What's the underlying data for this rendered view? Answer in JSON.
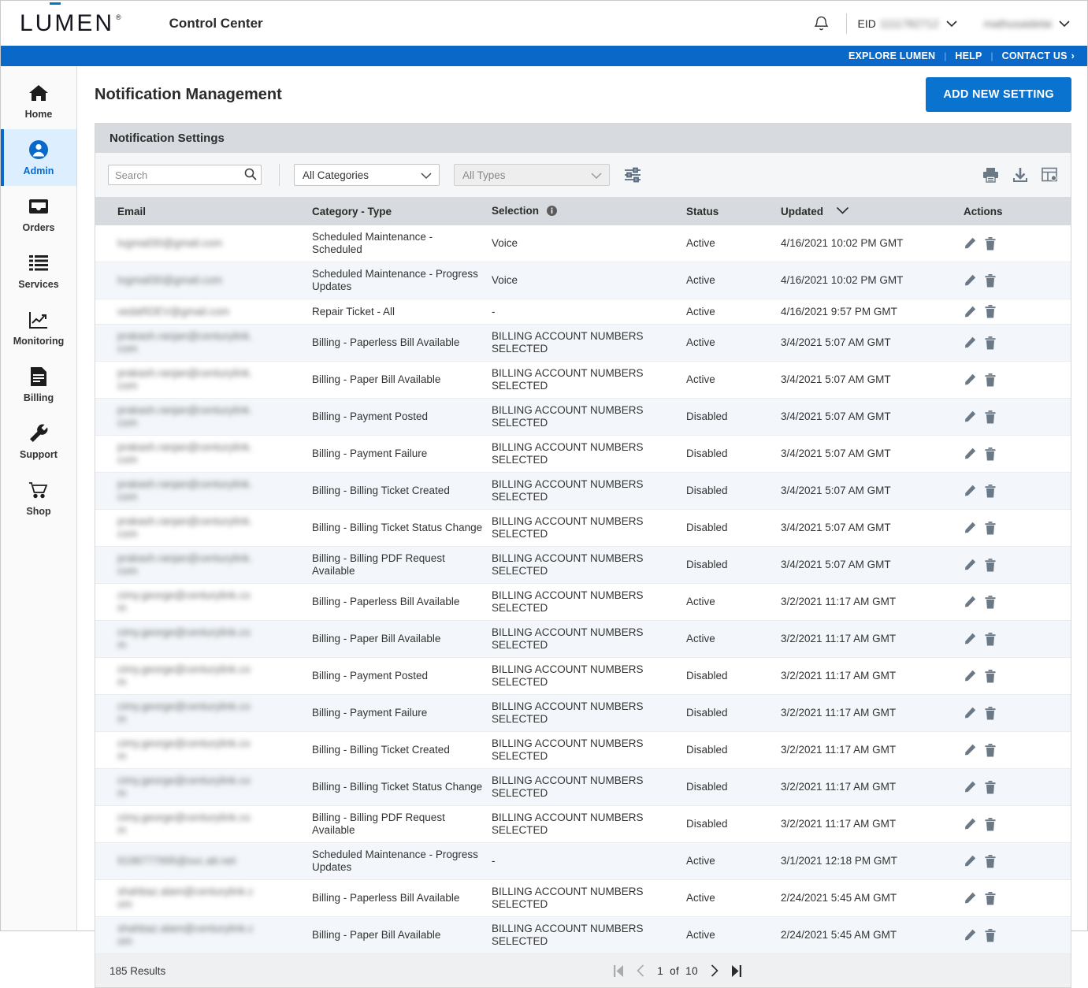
{
  "header": {
    "logo_text": "LUMEN",
    "logo_registered": "®",
    "app_title": "Control Center",
    "bell_icon": "bell-icon",
    "eid_label": "EID",
    "eid_value": "1111782712",
    "account_value": "mathusaidelai",
    "chevron": "⌄"
  },
  "bluebar": {
    "explore": "EXPLORE LUMEN",
    "help": "HELP",
    "contact": "CONTACT US",
    "contact_arrow": "›",
    "separator": "|"
  },
  "sidebar": {
    "items": [
      {
        "label": "Home",
        "icon": "home-icon",
        "active": false
      },
      {
        "label": "Admin",
        "icon": "user-circle-icon",
        "active": true
      },
      {
        "label": "Orders",
        "icon": "inbox-icon",
        "active": false
      },
      {
        "label": "Services",
        "icon": "list-icon",
        "active": false
      },
      {
        "label": "Monitoring",
        "icon": "chart-line-icon",
        "active": false
      },
      {
        "label": "Billing",
        "icon": "invoice-icon",
        "active": false
      },
      {
        "label": "Support",
        "icon": "wrench-icon",
        "active": false
      },
      {
        "label": "Shop",
        "icon": "cart-icon",
        "active": false
      }
    ]
  },
  "page": {
    "title": "Notification Management",
    "add_button": "ADD NEW SETTING",
    "panel_title": "Notification Settings"
  },
  "toolbar": {
    "search_placeholder": "Search",
    "search_value": "",
    "search_icon": "search-icon",
    "category_filter": "All Categories",
    "type_filter": "All Types",
    "filter_icon": "sliders-icon",
    "print_icon": "print-icon",
    "download_icon": "download-icon",
    "columns_icon": "table-settings-icon"
  },
  "table": {
    "columns": {
      "email": "Email",
      "category": "Category - Type",
      "selection": "Selection",
      "status": "Status",
      "updated": "Updated",
      "actions": "Actions"
    },
    "selection_info_icon": "info-icon",
    "updated_sort_icon": "chevron-down-icon",
    "edit_icon": "pencil-icon",
    "delete_icon": "trash-icon",
    "rows": [
      {
        "email": "tvgmail30@gmail.com",
        "category": "Scheduled Maintenance - Scheduled",
        "selection": "Voice",
        "status": "Active",
        "updated": "4/16/2021 10:02 PM GMT"
      },
      {
        "email": "tvgmail30@gmail.com",
        "category": "Scheduled Maintenance - Progress Updates",
        "selection": "Voice",
        "status": "Active",
        "updated": "4/16/2021 10:02 PM GMT"
      },
      {
        "email": "vedaRDEV@gmail.com",
        "category": "Repair Ticket - All",
        "selection": "-",
        "status": "Active",
        "updated": "4/16/2021 9:57 PM GMT"
      },
      {
        "email": "prakash.ranjan@centurylink.com",
        "category": "Billing - Paperless Bill Available",
        "selection": "BILLING ACCOUNT NUMBERS SELECTED",
        "status": "Active",
        "updated": "3/4/2021 5:07 AM GMT"
      },
      {
        "email": "prakash.ranjan@centurylink.com",
        "category": "Billing - Paper Bill Available",
        "selection": "BILLING ACCOUNT NUMBERS SELECTED",
        "status": "Active",
        "updated": "3/4/2021 5:07 AM GMT"
      },
      {
        "email": "prakash.ranjan@centurylink.com",
        "category": "Billing - Payment Posted",
        "selection": "BILLING ACCOUNT NUMBERS SELECTED",
        "status": "Disabled",
        "updated": "3/4/2021 5:07 AM GMT"
      },
      {
        "email": "prakash.ranjan@centurylink.com",
        "category": "Billing - Payment Failure",
        "selection": "BILLING ACCOUNT NUMBERS SELECTED",
        "status": "Disabled",
        "updated": "3/4/2021 5:07 AM GMT"
      },
      {
        "email": "prakash.ranjan@centurylink.com",
        "category": "Billing - Billing Ticket Created",
        "selection": "BILLING ACCOUNT NUMBERS SELECTED",
        "status": "Disabled",
        "updated": "3/4/2021 5:07 AM GMT"
      },
      {
        "email": "prakash.ranjan@centurylink.com",
        "category": "Billing - Billing Ticket Status Change",
        "selection": "BILLING ACCOUNT NUMBERS SELECTED",
        "status": "Disabled",
        "updated": "3/4/2021 5:07 AM GMT"
      },
      {
        "email": "prakash.ranjan@centurylink.com",
        "category": "Billing - Billing PDF Request Available",
        "selection": "BILLING ACCOUNT NUMBERS SELECTED",
        "status": "Disabled",
        "updated": "3/4/2021 5:07 AM GMT"
      },
      {
        "email": "cimy.george@centurylink.com",
        "category": "Billing - Paperless Bill Available",
        "selection": "BILLING ACCOUNT NUMBERS SELECTED",
        "status": "Active",
        "updated": "3/2/2021 11:17 AM GMT"
      },
      {
        "email": "cimy.george@centurylink.com",
        "category": "Billing - Paper Bill Available",
        "selection": "BILLING ACCOUNT NUMBERS SELECTED",
        "status": "Active",
        "updated": "3/2/2021 11:17 AM GMT"
      },
      {
        "email": "cimy.george@centurylink.com",
        "category": "Billing - Payment Posted",
        "selection": "BILLING ACCOUNT NUMBERS SELECTED",
        "status": "Disabled",
        "updated": "3/2/2021 11:17 AM GMT"
      },
      {
        "email": "cimy.george@centurylink.com",
        "category": "Billing - Payment Failure",
        "selection": "BILLING ACCOUNT NUMBERS SELECTED",
        "status": "Disabled",
        "updated": "3/2/2021 11:17 AM GMT"
      },
      {
        "email": "cimy.george@centurylink.com",
        "category": "Billing - Billing Ticket Created",
        "selection": "BILLING ACCOUNT NUMBERS SELECTED",
        "status": "Disabled",
        "updated": "3/2/2021 11:17 AM GMT"
      },
      {
        "email": "cimy.george@centurylink.com",
        "category": "Billing - Billing Ticket Status Change",
        "selection": "BILLING ACCOUNT NUMBERS SELECTED",
        "status": "Disabled",
        "updated": "3/2/2021 11:17 AM GMT"
      },
      {
        "email": "cimy.george@centurylink.com",
        "category": "Billing - Billing PDF Request Available",
        "selection": "BILLING ACCOUNT NUMBERS SELECTED",
        "status": "Disabled",
        "updated": "3/2/2021 11:17 AM GMT"
      },
      {
        "email": "9198777995@svc.att.net",
        "category": "Scheduled Maintenance - Progress Updates",
        "selection": "-",
        "status": "Active",
        "updated": "3/1/2021 12:18 PM GMT"
      },
      {
        "email": "shahbaz.alam@centurylink.com",
        "category": "Billing - Paperless Bill Available",
        "selection": "BILLING ACCOUNT NUMBERS SELECTED",
        "status": "Active",
        "updated": "2/24/2021 5:45 AM GMT"
      },
      {
        "email": "shahbaz.alam@centurylink.com",
        "category": "Billing - Paper Bill Available",
        "selection": "BILLING ACCOUNT NUMBERS SELECTED",
        "status": "Active",
        "updated": "2/24/2021 5:45 AM GMT"
      }
    ]
  },
  "pager": {
    "results": "185 Results",
    "page_current": "1",
    "page_of": "of",
    "page_total": "10",
    "first_icon": "first-page-icon",
    "prev_icon": "prev-page-icon",
    "next_icon": "next-page-icon",
    "last_icon": "last-page-icon"
  },
  "colors": {
    "brand_blue": "#0a69c8",
    "button_blue": "#0a72cf",
    "active_nav_bg": "#ddeeff",
    "header_gray": "#d7dade"
  }
}
